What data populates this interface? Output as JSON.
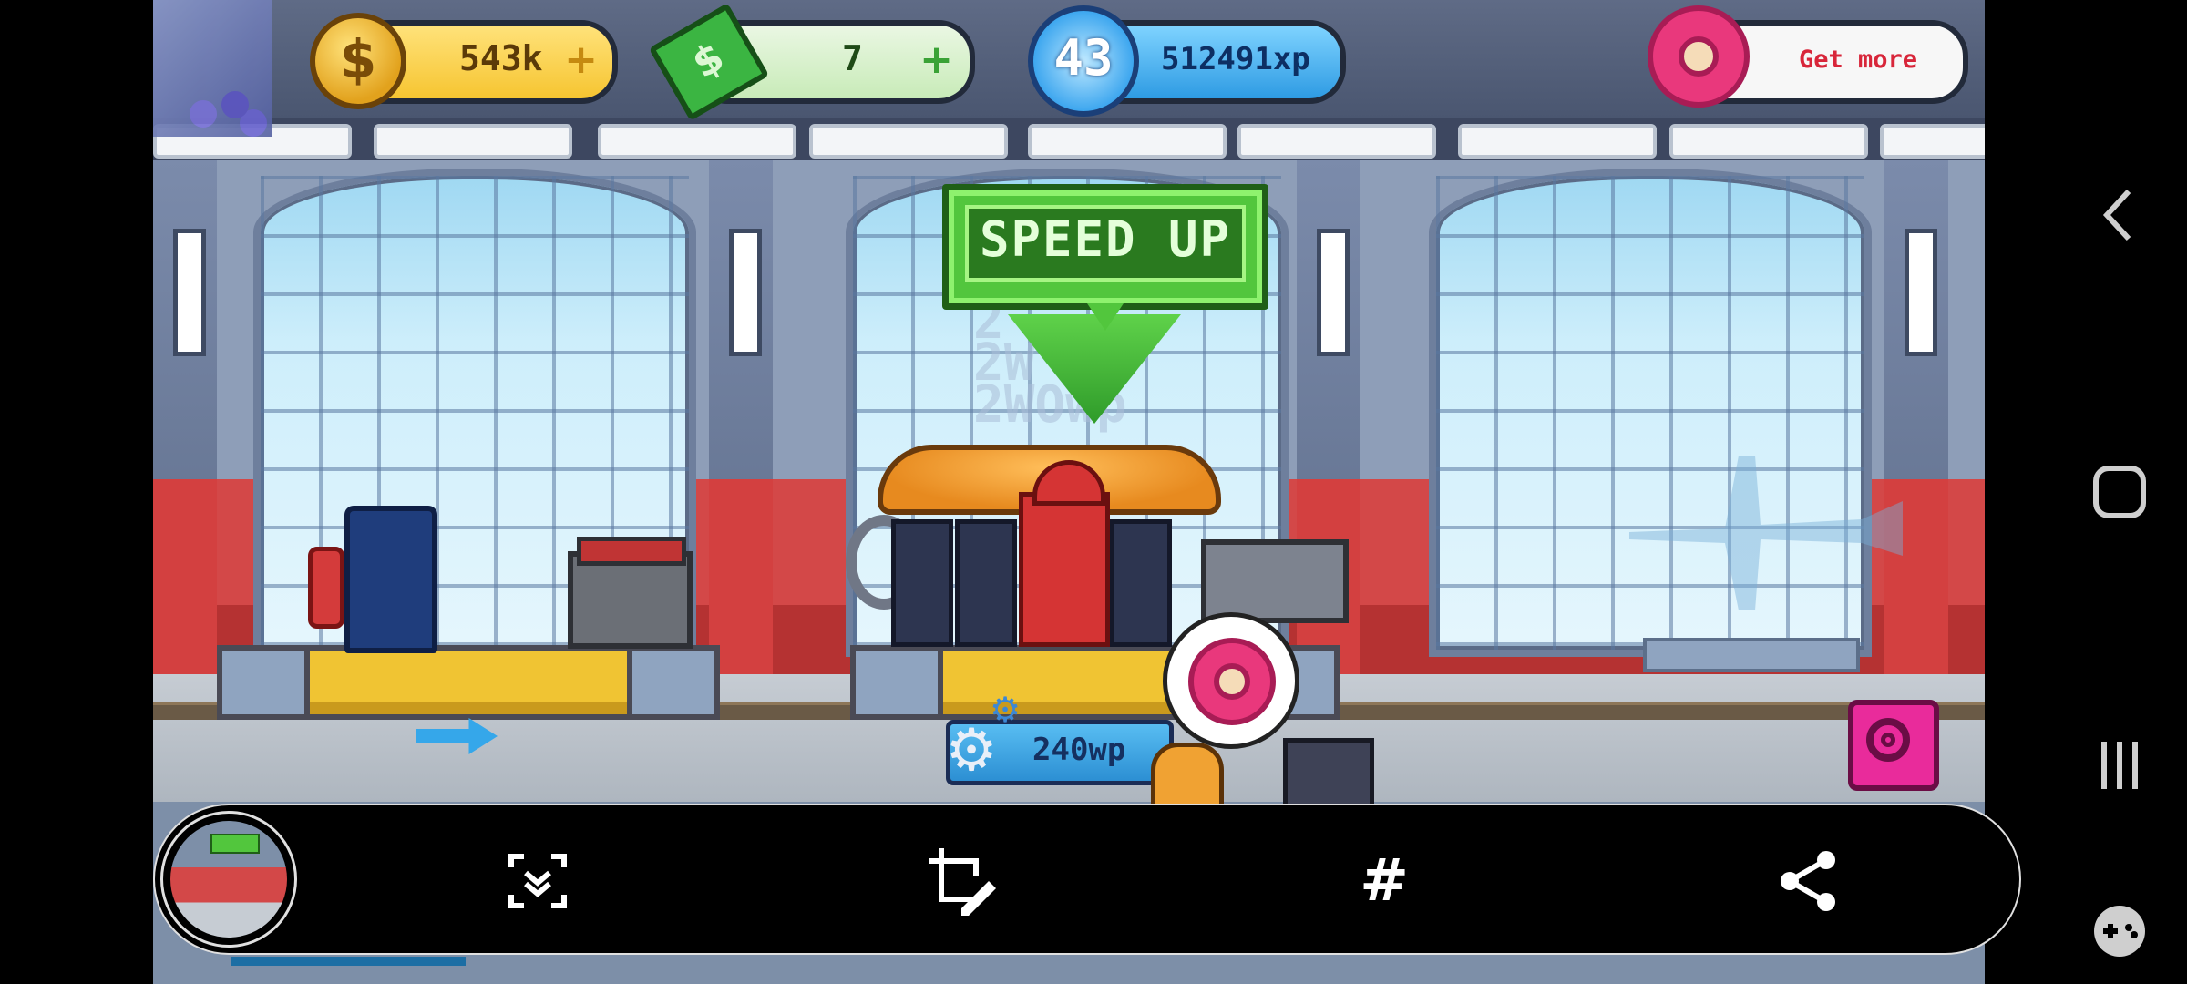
{
  "hud": {
    "coins": "543k",
    "cash": "7",
    "level": "43",
    "xp": "512491xp",
    "donut_cta": "Get more"
  },
  "banner": {
    "label": "SPEED UP"
  },
  "scene": {
    "wp_gauge": "240wp",
    "faded_numbers": [
      "2",
      "2W",
      "2WOwp"
    ]
  },
  "toolbar": {
    "buttons": [
      "scroll-capture",
      "draw-crop",
      "tags",
      "share"
    ],
    "hashtag_glyph": "#"
  },
  "icons": {
    "coin": "$",
    "cash": "$",
    "plus": "+"
  },
  "colors": {
    "banner_green": "#52c63d",
    "donut_pink": "#e9387c",
    "toolbar_bg": "#000000",
    "get_more_red": "#d8263a"
  }
}
